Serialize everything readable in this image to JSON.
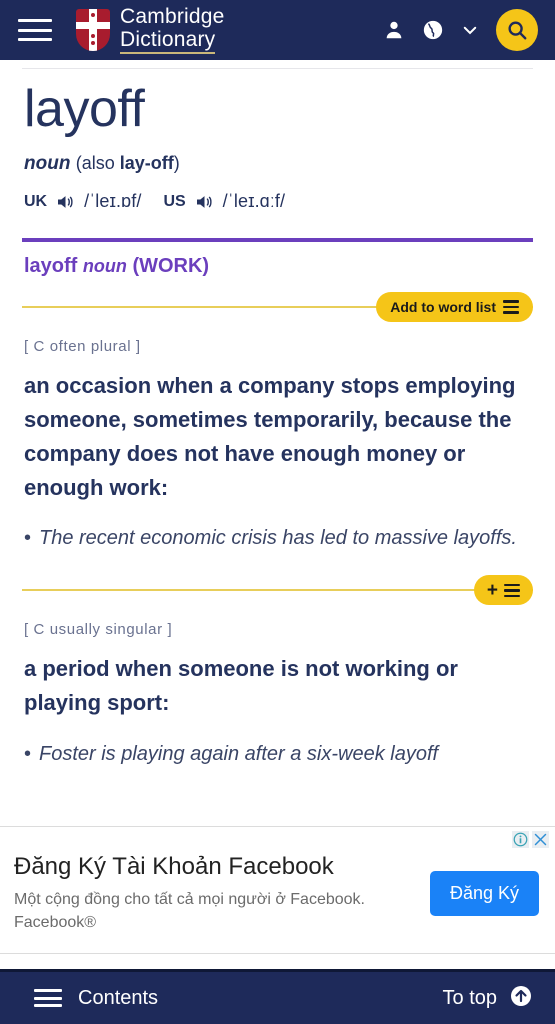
{
  "header": {
    "menu_icon": "hamburger-icon",
    "brand_line1": "Cambridge",
    "brand_line2": "Dictionary",
    "account_icon": "person-icon",
    "globe_icon": "globe-icon",
    "chevron_icon": "chevron-down-icon",
    "search_icon": "search-icon"
  },
  "entry": {
    "headword": "layoff",
    "pos": "noun",
    "also_prefix": "(also ",
    "also_word": "lay-off",
    "also_suffix": ")",
    "uk_label": "UK",
    "uk_ipa": "/ˈleɪ.ɒf/",
    "us_label": "US",
    "us_ipa": "/ˈleɪ.ɑːf/",
    "speaker_icon": "speaker-icon"
  },
  "sense_header": {
    "word": "layoff",
    "pos": "noun",
    "guideword": "(WORK)"
  },
  "buttons": {
    "add_to_word_list": "Add to word list",
    "list_icon": "list-icon",
    "plus_icon": "plus-icon"
  },
  "senses": [
    {
      "grammar": "[ C often plural ]",
      "definition": "an occasion when a company stops employing someone, sometimes temporarily, because the company does not have enough money or enough work:",
      "examples": [
        "The recent economic crisis has led to massive layoffs."
      ]
    },
    {
      "grammar": "[ C usually singular ]",
      "definition": "a period when someone is not working or playing sport:",
      "examples": [
        "Foster is playing again after a six-week layoff"
      ]
    }
  ],
  "ad": {
    "title": "Đăng Ký Tài Khoản Facebook",
    "description": "Một cộng đồng cho tất cả mọi người ở Facebook. Facebook®",
    "cta": "Đăng Ký",
    "info_icon": "info-icon",
    "close_icon": "close-icon"
  },
  "bottom_bar": {
    "contents_label": "Contents",
    "contents_icon": "hamburger-icon",
    "to_top_label": "To top",
    "to_top_icon": "arrow-up-circle-icon"
  },
  "colors": {
    "header_bg": "#1e2a5a",
    "accent_yellow": "#f5c518",
    "guideword_purple": "#6b3fbd",
    "text_navy": "#25335e",
    "ad_blue": "#1a82f7"
  }
}
